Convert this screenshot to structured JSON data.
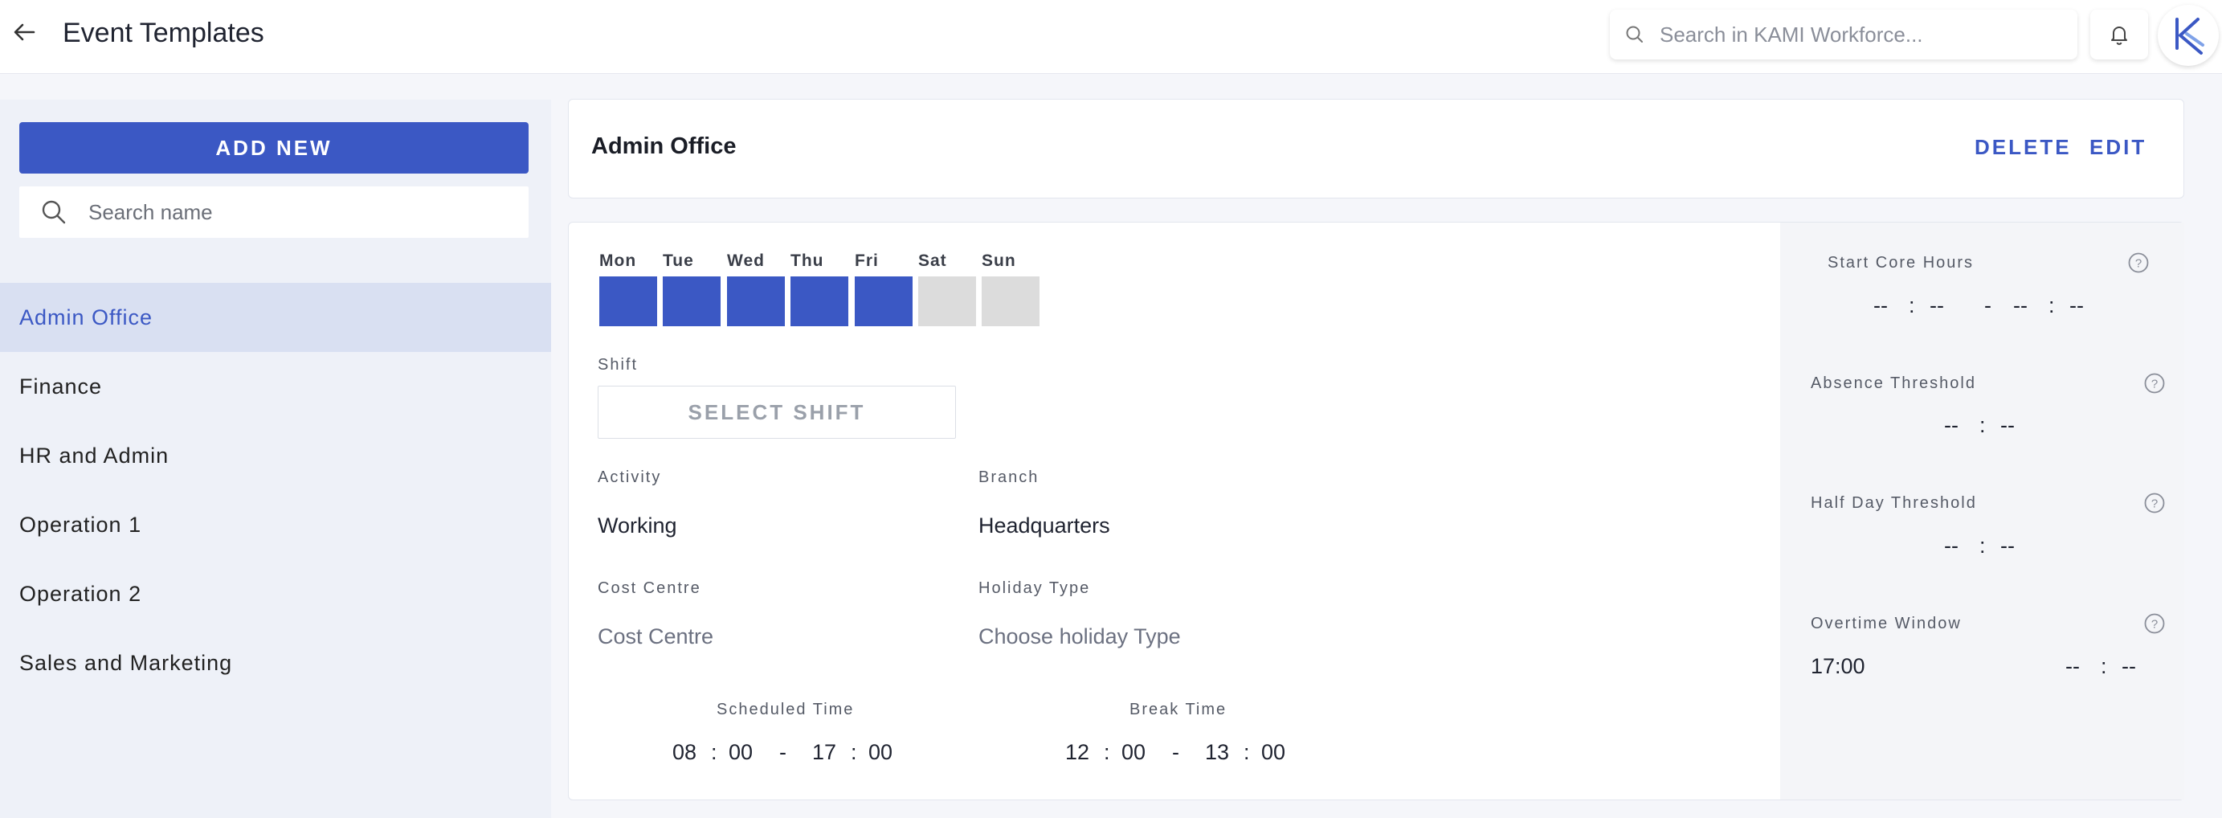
{
  "header": {
    "title": "Event Templates",
    "search_placeholder": "Search in KAMI Workforce..."
  },
  "sidebar": {
    "add_new_label": "ADD NEW",
    "search_placeholder": "Search name",
    "items": [
      {
        "label": "Admin Office",
        "active": true
      },
      {
        "label": "Finance"
      },
      {
        "label": "HR and Admin"
      },
      {
        "label": "Operation 1"
      },
      {
        "label": "Operation 2"
      },
      {
        "label": "Sales and Marketing"
      }
    ]
  },
  "detail": {
    "title": "Admin Office",
    "delete_label": "DELETE",
    "edit_label": "EDIT",
    "days": [
      {
        "label": "Mon",
        "selected": true
      },
      {
        "label": "Tue",
        "selected": true
      },
      {
        "label": "Wed",
        "selected": true
      },
      {
        "label": "Thu",
        "selected": true
      },
      {
        "label": "Fri",
        "selected": true
      },
      {
        "label": "Sat",
        "selected": false
      },
      {
        "label": "Sun",
        "selected": false
      }
    ],
    "shift_label": "Shift",
    "select_shift_label": "SELECT SHIFT",
    "activity_label": "Activity",
    "activity_value": "Working",
    "branch_label": "Branch",
    "branch_value": "Headquarters",
    "cost_centre_label": "Cost Centre",
    "cost_centre_placeholder": "Cost Centre",
    "holiday_type_label": "Holiday Type",
    "holiday_type_placeholder": "Choose holiday Type",
    "scheduled_time": {
      "label": "Scheduled Time",
      "start_h": "08",
      "start_m": "00",
      "end_h": "17",
      "end_m": "00"
    },
    "break_time": {
      "label": "Break Time",
      "start_h": "12",
      "start_m": "00",
      "end_h": "13",
      "end_m": "00"
    },
    "start_core_hours": {
      "label": "Start Core Hours",
      "start_h": "--",
      "start_m": "--",
      "end_h": "--",
      "end_m": "--"
    },
    "absence_threshold": {
      "label": "Absence Threshold",
      "h": "--",
      "m": "--"
    },
    "half_day_threshold": {
      "label": "Half Day Threshold",
      "h": "--",
      "m": "--"
    },
    "overtime_window": {
      "label": "Overtime Window",
      "value": "17:00",
      "h": "--",
      "m": "--"
    },
    "colon": ":",
    "dash": "-"
  },
  "colors": {
    "accent": "#3b58c4",
    "active_item_bg": "#d9e0f2",
    "day_off": "#dcdcdc"
  }
}
